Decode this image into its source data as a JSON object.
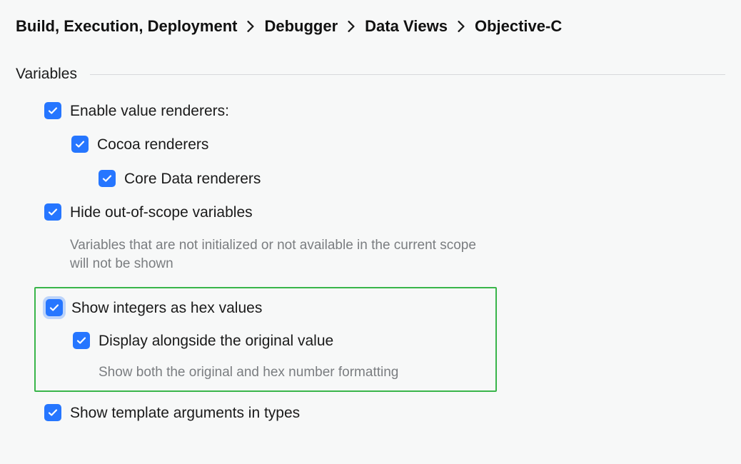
{
  "breadcrumb": {
    "items": [
      "Build, Execution, Deployment",
      "Debugger",
      "Data Views",
      "Objective-C"
    ]
  },
  "section": {
    "title": "Variables"
  },
  "options": {
    "enable_value_renderers": {
      "label": "Enable value renderers:"
    },
    "cocoa_renderers": {
      "label": "Cocoa renderers"
    },
    "core_data_renderers": {
      "label": "Core Data renderers"
    },
    "hide_out_of_scope": {
      "label": "Hide out-of-scope variables",
      "desc": "Variables that are not initialized or not available in the current scope will not be shown"
    },
    "show_integers_hex": {
      "label": "Show integers as hex values"
    },
    "display_alongside": {
      "label": "Display alongside the original value",
      "desc": "Show both the original and hex number formatting"
    },
    "show_template_args": {
      "label": "Show template arguments in types"
    }
  }
}
